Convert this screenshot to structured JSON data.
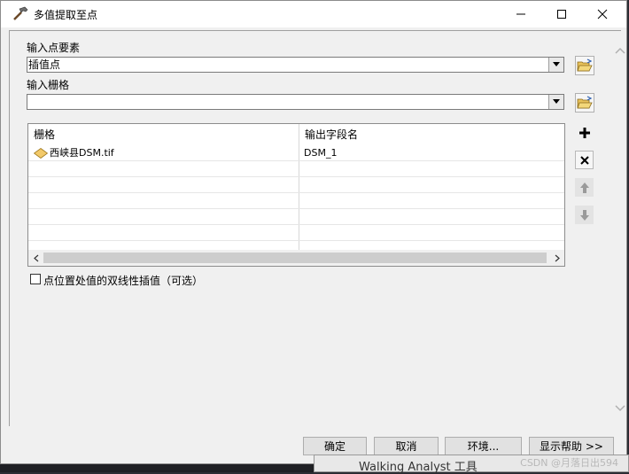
{
  "window": {
    "title": "多值提取至点",
    "minimize_icon": "minimize-icon",
    "maximize_icon": "maximize-icon",
    "close_icon": "close-icon"
  },
  "form": {
    "input_points_label": "输入点要素",
    "input_points_value": "插值点",
    "input_rasters_label": "输入栅格",
    "input_rasters_value": "",
    "table": {
      "columns": [
        "栅格",
        "输出字段名"
      ],
      "rows": [
        {
          "raster": "西峡县DSM.tif",
          "field": "DSM_1"
        }
      ]
    },
    "bilinear_label": "点位置处值的双线性插值（可选）",
    "bilinear_checked": false
  },
  "buttons": {
    "ok": "确定",
    "cancel": "取消",
    "env": "环境...",
    "help": "显示帮助 >>"
  },
  "background": {
    "taskbar_text": "Walking Analyst 工具",
    "watermark": "CSDN @月落日出594"
  },
  "colors": {
    "window_bg": "#f0f0f0",
    "titlebar_bg": "#ffffff",
    "raster_icon": "#f2c969"
  }
}
